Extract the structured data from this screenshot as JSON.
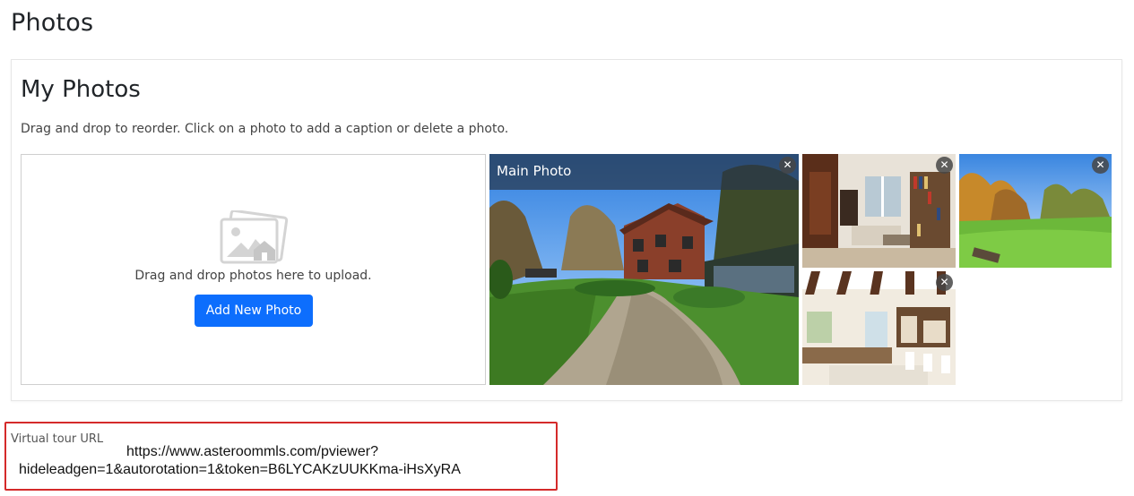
{
  "page": {
    "title": "Photos"
  },
  "photos_card": {
    "title": "My Photos",
    "description": "Drag and drop to reorder. Click on a photo to add a caption or delete a photo.",
    "dropzone": {
      "text": "Drag and drop photos here to upload.",
      "add_button": "Add New Photo",
      "icon": "photos-upload-icon"
    },
    "photos": [
      {
        "id": "main",
        "label": "Main Photo",
        "close": "✕",
        "icon": "house-exterior-photo"
      },
      {
        "id": "living",
        "close": "✕",
        "icon": "living-room-photo"
      },
      {
        "id": "lawn",
        "close": "✕",
        "icon": "garden-lawn-photo"
      },
      {
        "id": "kitchen",
        "close": "✕",
        "icon": "kitchen-photo"
      }
    ]
  },
  "virtual_tour": {
    "label": "Virtual tour URL",
    "url": "https://www.asteroommls.com/pviewer?hideleadgen=1&autorotation=1&token=B6LYCAKzUUKKma-iHsXyRA"
  },
  "colors": {
    "primary": "#0d6efd",
    "highlight_border": "#d42a2a"
  }
}
